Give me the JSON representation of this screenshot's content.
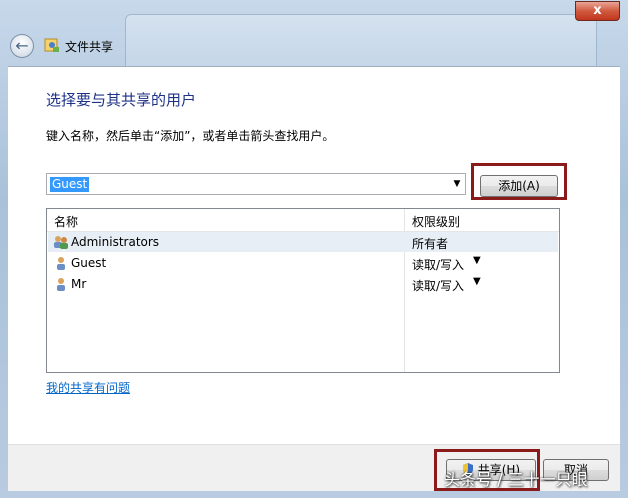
{
  "window": {
    "title": "文件共享",
    "close_glyph": "x"
  },
  "main": {
    "heading": "选择要与其共享的用户",
    "instruction": "键入名称，然后单击“添加”，或者单击箭头查找用户。",
    "combo_value": "Guest",
    "add_label": "添加(A)",
    "columns": {
      "name": "名称",
      "permission": "权限级别"
    },
    "rows": [
      {
        "name": "Administrators",
        "permission": "所有者",
        "has_dropdown": false,
        "icon": "group-users-icon"
      },
      {
        "name": "Guest",
        "permission": "读取/写入",
        "has_dropdown": true,
        "icon": "user-icon"
      },
      {
        "name": "Mr",
        "permission": "读取/写入",
        "has_dropdown": true,
        "icon": "user-icon"
      }
    ],
    "problem_link": "我的共享有问题"
  },
  "footer": {
    "share_label": "共享(H)",
    "cancel_label": "取消"
  },
  "watermark": "头条号 / 三十一只眼",
  "colors": {
    "heading": "#1e3287",
    "link": "#0066cc",
    "highlight": "#8b1a1a",
    "selection": "#3399ff"
  }
}
